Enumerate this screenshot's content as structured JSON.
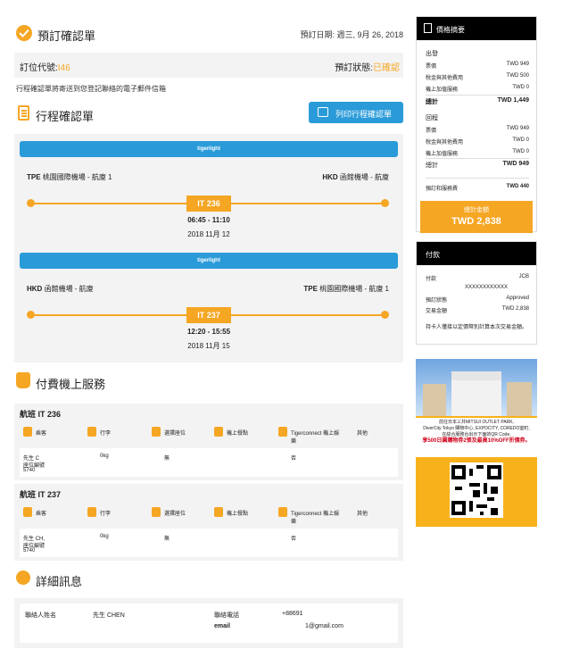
{
  "header": {
    "title": "預訂確認單",
    "date_label": "預訂日期: 週三, 9月 26, 2018"
  },
  "pnr": {
    "code_label": "訂位代號:",
    "code_value": "I46",
    "status_label": "預訂狀態:",
    "status_value": "已確認"
  },
  "email_note": "行程確認單將寄送到您登記聯絡的電子郵件信箱",
  "itinerary": {
    "title": "行程確認單",
    "print_label": "列印行程確認單",
    "flights": [
      {
        "brand": "tigerlight",
        "from_code": "TPE",
        "from_name": "桃園國際機場 - 航廈 1",
        "to_code": "HKD",
        "to_name": "函館機場 - 航廈",
        "flight_no": "IT 236",
        "time": "06:45 - 11:10",
        "date": "2018 11月 12"
      },
      {
        "brand": "tigerlight",
        "from_code": "HKD",
        "from_name": "函館機場 - 航廈",
        "to_code": "TPE",
        "to_name": "桃園國際機場 - 航廈 1",
        "flight_no": "IT 237",
        "time": "12:20 - 15:55",
        "date": "2018 11月 15"
      }
    ]
  },
  "services": {
    "title": "付費機上服務",
    "columns": [
      "乘客",
      "行李",
      "選擇座位",
      "機上餐點",
      "Tigerconnect 機上娛樂",
      "其他"
    ],
    "flights": [
      {
        "title": "航班 IT 236",
        "passenger": "先生 C",
        "passenger_sub": "座位編號",
        "seat": "5740",
        "baggage": "0kg",
        "seat_sel": "無",
        "entertain": "否"
      },
      {
        "title": "航班 IT 237",
        "passenger": "先生 CH,",
        "passenger_sub": "座位編號",
        "seat": "5740",
        "baggage": "0kg",
        "seat_sel": "無",
        "entertain": "否"
      }
    ]
  },
  "details": {
    "title": "詳細訊息",
    "contact_label": "聯絡人姓名",
    "contact_value": "先生 CHEN",
    "phone_label": "聯絡電話",
    "phone_value": "+88691",
    "email_label": "email",
    "email_value": "1@gmail.com"
  },
  "summary": {
    "title": "價格摘要",
    "out_label": "出發",
    "ret_label": "回程",
    "out": [
      {
        "k": "票價",
        "v": "TWD 949"
      },
      {
        "k": "稅金與其他費用",
        "v": "TWD 500"
      },
      {
        "k": "機上加值服務",
        "v": "TWD 0"
      }
    ],
    "out_total": {
      "k": "總計",
      "v": "TWD 1,449"
    },
    "ret": [
      {
        "k": "票價",
        "v": "TWD 949"
      },
      {
        "k": "稅金與其他費用",
        "v": "TWD 0"
      },
      {
        "k": "機上加值服務",
        "v": "TWD 0"
      }
    ],
    "ret_total": {
      "k": "總計",
      "v": "TWD 949"
    },
    "fee": {
      "k": "預訂和服務費",
      "v": "TWD 440"
    },
    "grand_label": "總計金額",
    "grand_value": "TWD 2,838"
  },
  "payment": {
    "title": "付款",
    "rows": [
      {
        "k": "付款",
        "v": "JCB"
      },
      {
        "k": "",
        "v": "XXXXXXXXXXXX"
      },
      {
        "k": "預訂狀態",
        "v": "Approved"
      },
      {
        "k": "交易金額",
        "v": "TWD 2,838"
      }
    ],
    "note": "持卡人僅接以定價幣別計算本次交易金額。"
  },
  "promo": {
    "line1": "前往日本三井MITSUI OUTLET PARK,",
    "line2": "DiverCity Tokyo 購物中心, EXPOCITY, COREDO室町,",
    "line3": "在綜合服務台出示下面的QR Code,",
    "line4": "享500日圓購物券2張及最高10%OFF折價券。"
  },
  "colors": {
    "accent": "#f5a623",
    "blue": "#2a9bd8"
  }
}
